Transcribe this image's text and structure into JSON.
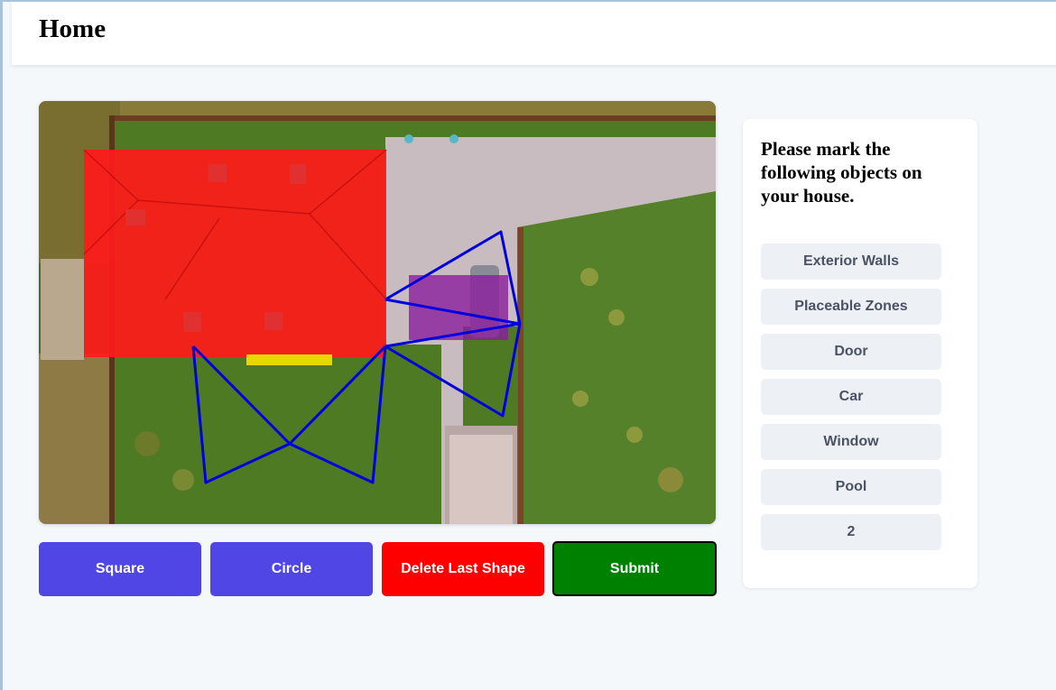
{
  "header": {
    "title": "Home"
  },
  "canvas": {
    "image": "aerial photo of house with marked shapes",
    "shape_colors": {
      "exterior_walls": "#ff1a1a",
      "car": "#8b1e9e",
      "door": "#e6d800",
      "outline": "#0000dd"
    }
  },
  "toolbar": {
    "square_label": "Square",
    "circle_label": "Circle",
    "delete_label": "Delete Last Shape",
    "submit_label": "Submit"
  },
  "panel": {
    "heading": "Please mark the following objects on your house.",
    "items": [
      {
        "label": "Exterior Walls"
      },
      {
        "label": "Placeable Zones"
      },
      {
        "label": "Door"
      },
      {
        "label": "Car"
      },
      {
        "label": "Window"
      },
      {
        "label": "Pool"
      },
      {
        "label": "2"
      }
    ]
  },
  "colors": {
    "primary": "#4f46e5",
    "danger": "#ff0000",
    "success": "#008000",
    "background": "#f4f8fb"
  }
}
